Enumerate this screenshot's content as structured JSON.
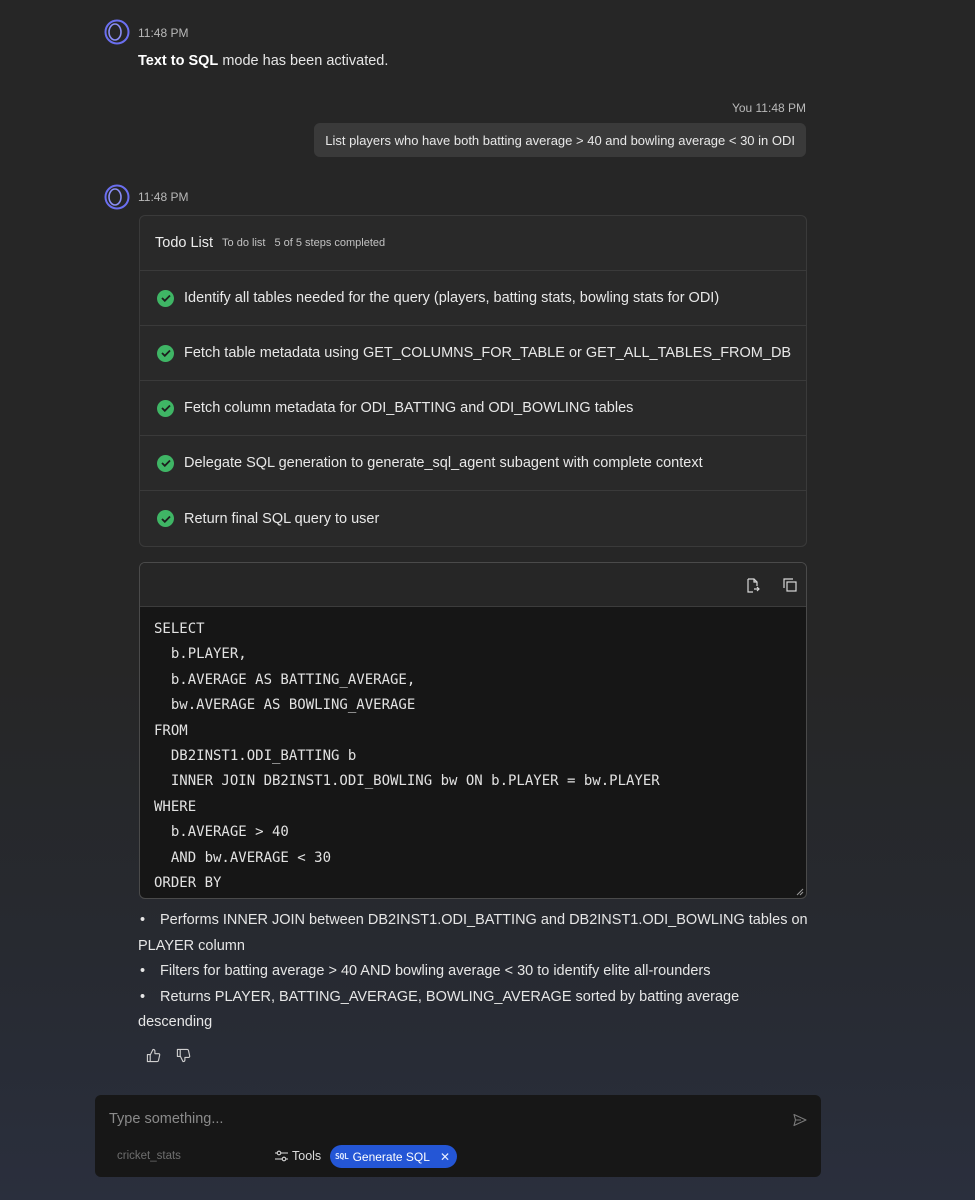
{
  "messages": {
    "system": {
      "time": "11:48 PM",
      "bold": "Text to SQL",
      "text": " mode has been activated."
    },
    "user": {
      "meta": "You 11:48 PM",
      "text": "List players who have both batting average > 40 and bowling average < 30 in ODI"
    },
    "assistant": {
      "time": "11:48 PM"
    }
  },
  "todo": {
    "title": "Todo List",
    "subtitle": "To do list",
    "progress": "5 of 5 steps completed",
    "items": [
      {
        "label": "Identify all tables needed for the query (players, batting stats, bowling stats for ODI)",
        "done": true
      },
      {
        "label": "Fetch table metadata using GET_COLUMNS_FOR_TABLE or GET_ALL_TABLES_FROM_DB",
        "done": true
      },
      {
        "label": "Fetch column metadata for ODI_BATTING and ODI_BOWLING tables",
        "done": true
      },
      {
        "label": "Delegate SQL generation to generate_sql_agent subagent with complete context",
        "done": true
      },
      {
        "label": "Return final SQL query to user",
        "done": true
      }
    ]
  },
  "code": {
    "lines": [
      "SELECT",
      "  b.PLAYER,",
      "  b.AVERAGE AS BATTING_AVERAGE,",
      "  bw.AVERAGE AS BOWLING_AVERAGE",
      "FROM",
      "  DB2INST1.ODI_BATTING b",
      "  INNER JOIN DB2INST1.ODI_BOWLING bw ON b.PLAYER = bw.PLAYER",
      "WHERE",
      "  b.AVERAGE > 40",
      "  AND bw.AVERAGE < 30",
      "ORDER BY"
    ]
  },
  "bullets": [
    "Performs INNER JOIN between DB2INST1.ODI_BATTING and DB2INST1.ODI_BOWLING tables on PLAYER column",
    "Filters for batting average > 40 AND bowling average < 30 to identify elite all-rounders",
    "Returns PLAYER, BATTING_AVERAGE, BOWLING_AVERAGE sorted by batting average descending"
  ],
  "composer": {
    "placeholder": "Type something...",
    "database": "cricket_stats",
    "tools_label": "Tools",
    "chip_tag": "SQL",
    "chip_label": "Generate SQL"
  },
  "colors": {
    "accent": "#2456d6",
    "success": "#3fb565",
    "avatar": "#6b6ff0"
  }
}
